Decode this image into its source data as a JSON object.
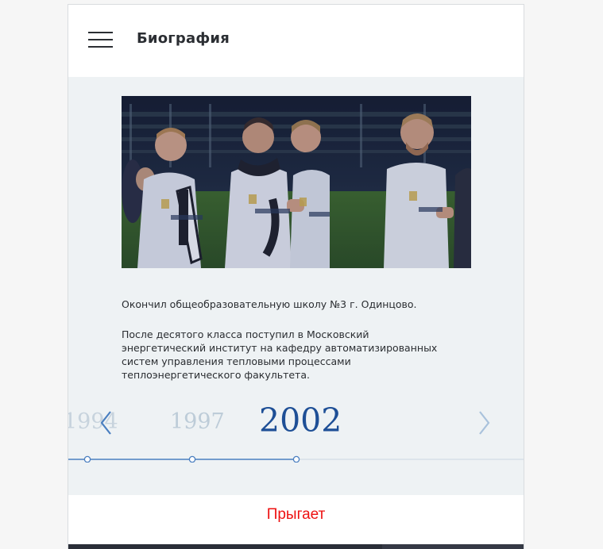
{
  "header": {
    "title": "Биография"
  },
  "bio": {
    "paragraph1": "Окончил общеобразовательную школу №3 г. Одинцово.",
    "paragraph2": "После десятого класса поступил в Московский энергетический институт на кафедру автоматизированных систем управления тепловыми процессами теплоэнергетического факультета."
  },
  "timeline": {
    "years": [
      "1994",
      "1997",
      "2002"
    ],
    "current_year": "2002",
    "prev_year": "1997",
    "prev_prev_year": "1994"
  },
  "status": {
    "text": "Прыгает"
  },
  "colors": {
    "accent": "#1e4f96",
    "status": "#ee1111",
    "content_bg": "#eef2f4",
    "arrow": "#4a7fc0"
  }
}
